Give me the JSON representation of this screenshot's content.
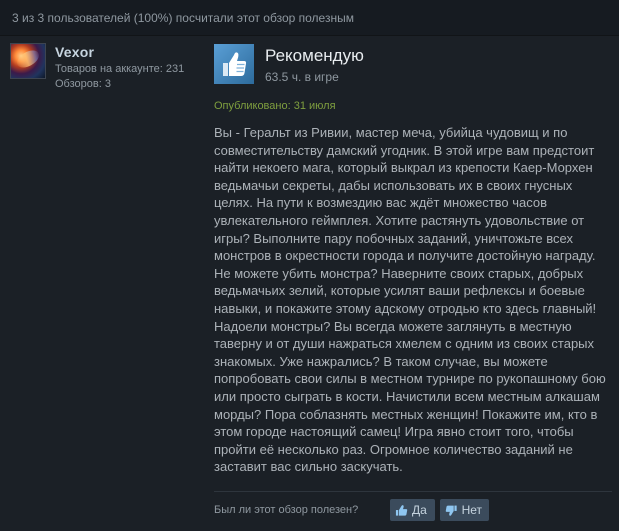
{
  "helpful_summary": "3 из 3 пользователей (100%) посчитали этот обзор полезным",
  "author": {
    "name": "Vexor",
    "products_label": "Товаров на аккаунте: 231",
    "reviews_label": "Обзоров: 3"
  },
  "review": {
    "verdict": "Рекомендую",
    "hours": "63.5 ч. в игре",
    "posted": "Опубликовано: 31 июля",
    "body": "Вы - Геральт из Ривии, мастер меча, убийца чудовищ и по совместительству дамский угодник. В этой игре вам предстоит найти некоего мага, который выкрал из крепости Каер-Морхен ведьмачьи секреты, дабы использовать их в своих гнусных целях. На пути к возмездию вас ждёт множество часов увлекательного геймплея. Хотите растянуть удовольствие от игры? Выполните пару побочных заданий, уничтожьте всех монстров в окрестности города и получите достойную награду. Не можете убить монстра? Наверните своих старых, добрых ведьмачьих зелий, которые усилят ваши рефлексы и боевые навыки, и покажите этому адскому отродью кто здесь главный! Надоели монстры? Вы всегда можете заглянуть в местную таверну и от души нажраться хмелем с одним из своих старых знакомых. Уже нажрались? В таком случае, вы можете попробовать свои силы в местном турнире по рукопашному бою или просто сыграть в кости. Начистили всем местным алкашам морды? Пора соблазнять местных женщин! Покажите им, кто в этом городе настоящий самец! Игра явно стоит того, чтобы пройти её несколько раз. Огромное количество заданий не заставит вас сильно заскучать."
  },
  "vote": {
    "prompt": "Был ли этот обзор полезен?",
    "yes_label": "Да",
    "no_label": "Нет"
  },
  "icons": {
    "recommend": "thumbs-up-icon",
    "vote_yes": "thumbs-up-icon",
    "vote_no": "thumbs-down-icon"
  },
  "colors": {
    "background": "#1b2026",
    "header_bar": "#161b21",
    "posted_green": "#7f9f3f",
    "thumb_blue": "#4a8ec4",
    "button": "#3b4b5c"
  }
}
